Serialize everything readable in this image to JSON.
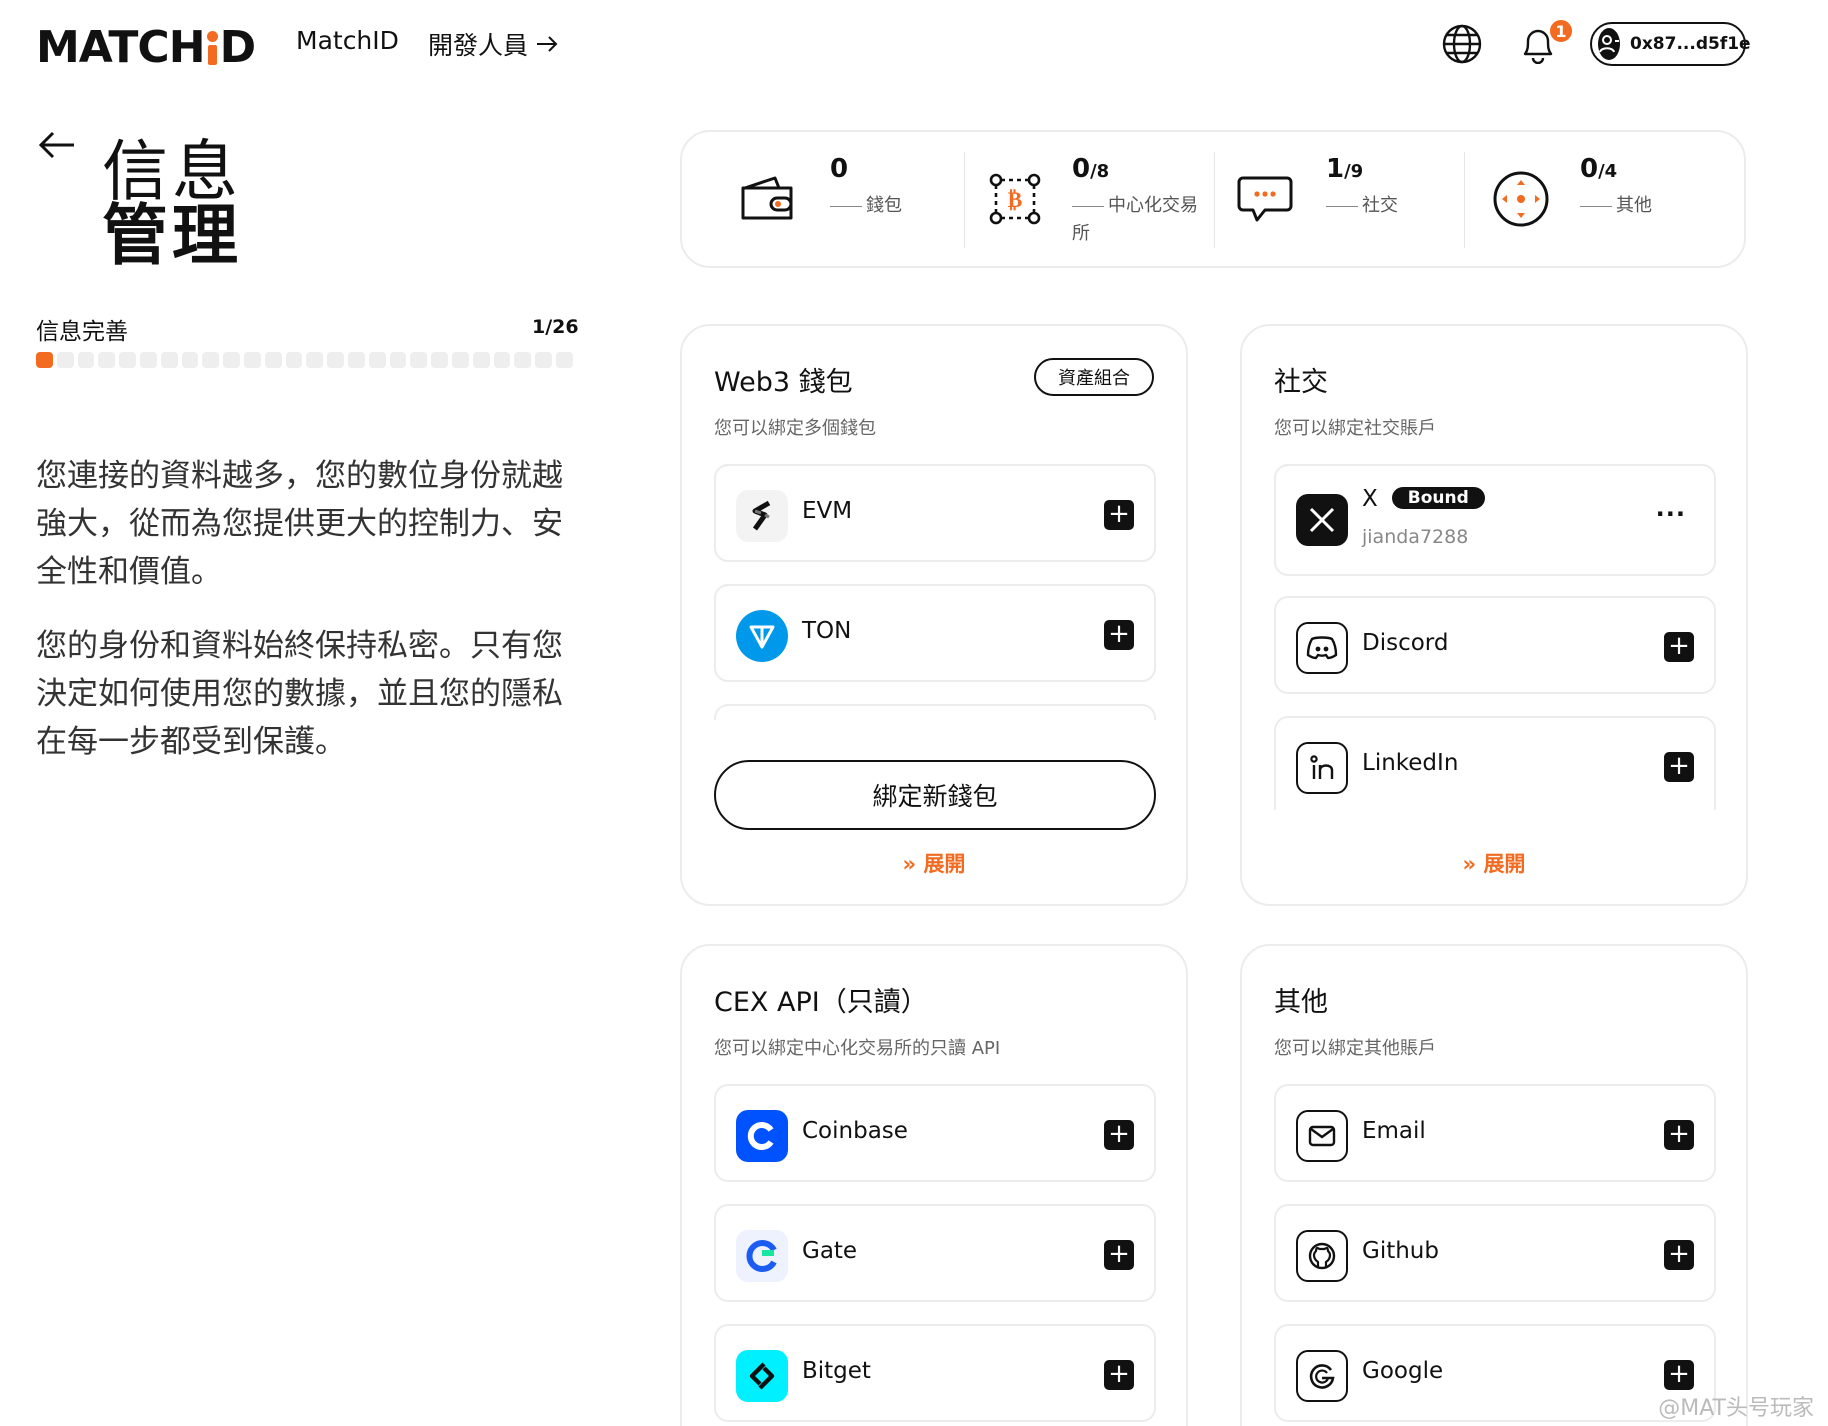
{
  "header": {
    "logo": "MATCHID",
    "nav": [
      "MatchID",
      "開發人員"
    ],
    "notification_count": "1",
    "wallet_address": "0x87...d5f1e"
  },
  "page": {
    "title_line1": "信息",
    "title_line2": "管理",
    "progress_label": "信息完善",
    "progress_count": "1/26",
    "progress": {
      "done": 1,
      "total": 26
    },
    "desc1": "您連接的資料越多，您的數位身份就越強大，從而為您提供更大的控制力、安全性和價值。",
    "desc2": "您的身份和資料始終保持私密。只有您決定如何使用您的數據，並且您的隱私在每一步都受到保護。"
  },
  "stats": [
    {
      "num": "0",
      "den": "",
      "label": "錢包",
      "icon": "wallet-icon"
    },
    {
      "num": "0",
      "den": "/8",
      "label": "中心化交易所",
      "icon": "exchange-icon"
    },
    {
      "num": "1",
      "den": "/9",
      "label": "社交",
      "icon": "chat-icon"
    },
    {
      "num": "0",
      "den": "/4",
      "label": "其他",
      "icon": "move-icon"
    }
  ],
  "web3": {
    "title": "Web3 錢包",
    "subtitle": "您可以綁定多個錢包",
    "portfolio_btn": "資產組合",
    "items": [
      "EVM",
      "TON"
    ],
    "bind_btn": "綁定新錢包",
    "expand": "展開"
  },
  "social": {
    "title": "社交",
    "subtitle": "您可以綁定社交賬戶",
    "x_name": "X",
    "x_badge": "Bound",
    "x_handle": "jianda7288",
    "items": [
      "Discord",
      "LinkedIn"
    ],
    "expand": "展開"
  },
  "cex": {
    "title": "CEX API（只讀）",
    "subtitle": "您可以綁定中心化交易所的只讀 API",
    "items": [
      "Coinbase",
      "Gate",
      "Bitget"
    ]
  },
  "other": {
    "title": "其他",
    "subtitle": "您可以綁定其他賬戶",
    "items": [
      "Email",
      "Github",
      "Google"
    ]
  },
  "watermark": "@MAT头号玩家",
  "colors": {
    "accent": "#f26b21",
    "ton": "#0098ea",
    "coinbase": "#0052ff",
    "bitget": "#00f0ff"
  }
}
